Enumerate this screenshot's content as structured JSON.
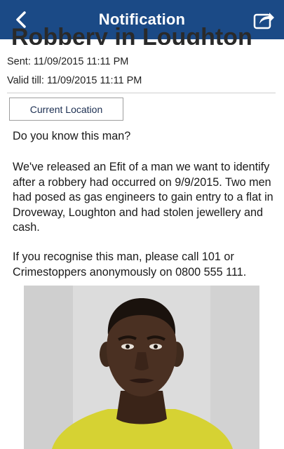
{
  "header": {
    "title": "Notification",
    "back_icon": "chevron-left-icon",
    "share_icon": "share-icon",
    "color": "#1b4a86"
  },
  "message": {
    "heading_cut": "Robbery in Loughton",
    "sent": "Sent: 11/09/2015 11:11 PM",
    "valid_till": "Valid till: 11/09/2015 11:11 PM",
    "location_button": "Current Location",
    "paragraphs": [
      "Do you know this man?",
      "We've released an Efit of a man we want to identify after a robbery had occurred on 9/9/2015. Two men had posed as gas engineers to gain entry to a flat in Droveway, Loughton and had stolen jewellery and cash.",
      "If you recognise this man, please call 101 or Crimestoppers anonymously on 0800 555 111."
    ]
  }
}
